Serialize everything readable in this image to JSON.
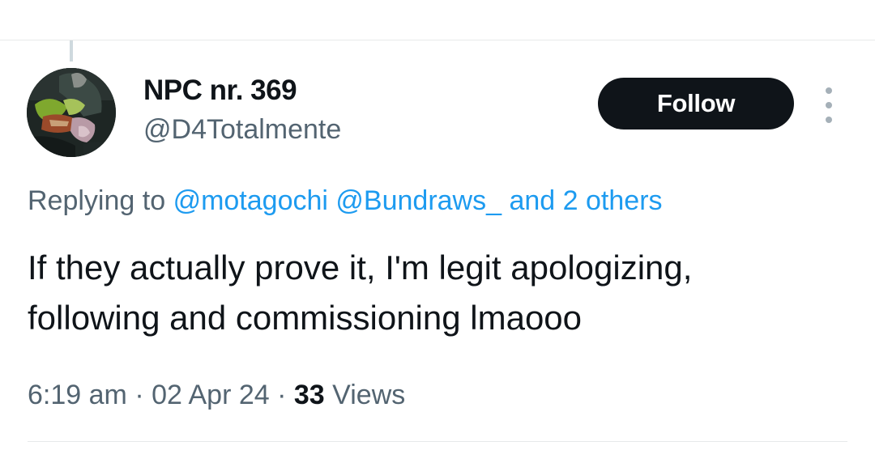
{
  "author": {
    "display_name": "NPC nr. 369",
    "handle": "@D4Totalmente"
  },
  "follow_label": "Follow",
  "more_icon": "more-vertical-icon",
  "reply_context": {
    "prefix": "Replying to",
    "mention_1": "@motagochi",
    "mention_2": "@Bundraws_",
    "others": "and 2 others"
  },
  "tweet": {
    "line_1": "If they actually prove it, I'm legit apologizing,",
    "line_2": "following and commissioning lmaooo"
  },
  "meta": {
    "time": "6:19 am",
    "separator": "·",
    "date": "02 Apr 24",
    "views_count": "33",
    "views_label": "Views"
  },
  "colors": {
    "text": "#0f1419",
    "secondary": "#536471",
    "link": "#1d9bf0",
    "button_bg": "#0f1419",
    "divider": "#e7e9ea"
  }
}
